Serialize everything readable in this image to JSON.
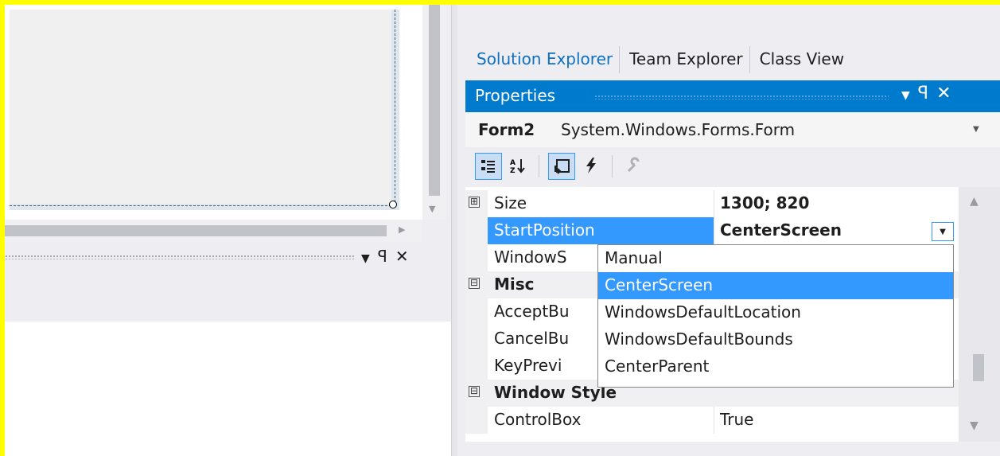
{
  "designer": {},
  "lower_panel": {
    "pin_icon": "pin-icon",
    "close_icon": "close-icon"
  },
  "tabs": [
    "Solution Explorer",
    "Team Explorer",
    "Class View"
  ],
  "properties": {
    "title": "Properties",
    "object_name": "Form2",
    "object_type": "System.Windows.Forms.Form",
    "toolbar_icons": [
      "categorized-icon",
      "alphabetical-icon",
      "properties-icon",
      "events-icon",
      "property-pages-icon"
    ],
    "rows": [
      {
        "name": "Size",
        "value": "1300; 820",
        "expander": "⊞"
      },
      {
        "name": "StartPosition",
        "value": "CenterScreen"
      },
      {
        "name": "WindowS",
        "value": ""
      },
      {
        "name": "Misc",
        "expander": "⊟"
      },
      {
        "name": "AcceptBu",
        "value": ""
      },
      {
        "name": "CancelBu",
        "value": ""
      },
      {
        "name": "KeyPrevi",
        "value": ""
      },
      {
        "name": "Window Style",
        "expander": "⊟"
      },
      {
        "name": "ControlBox",
        "value": "True"
      }
    ]
  },
  "startposition_options": [
    "Manual",
    "CenterScreen",
    "WindowsDefaultLocation",
    "WindowsDefaultBounds",
    "CenterParent"
  ],
  "selected_option": "CenterScreen",
  "colors": {
    "accent": "#007acc",
    "selection": "#3399ff",
    "frame": "#ffff00"
  }
}
